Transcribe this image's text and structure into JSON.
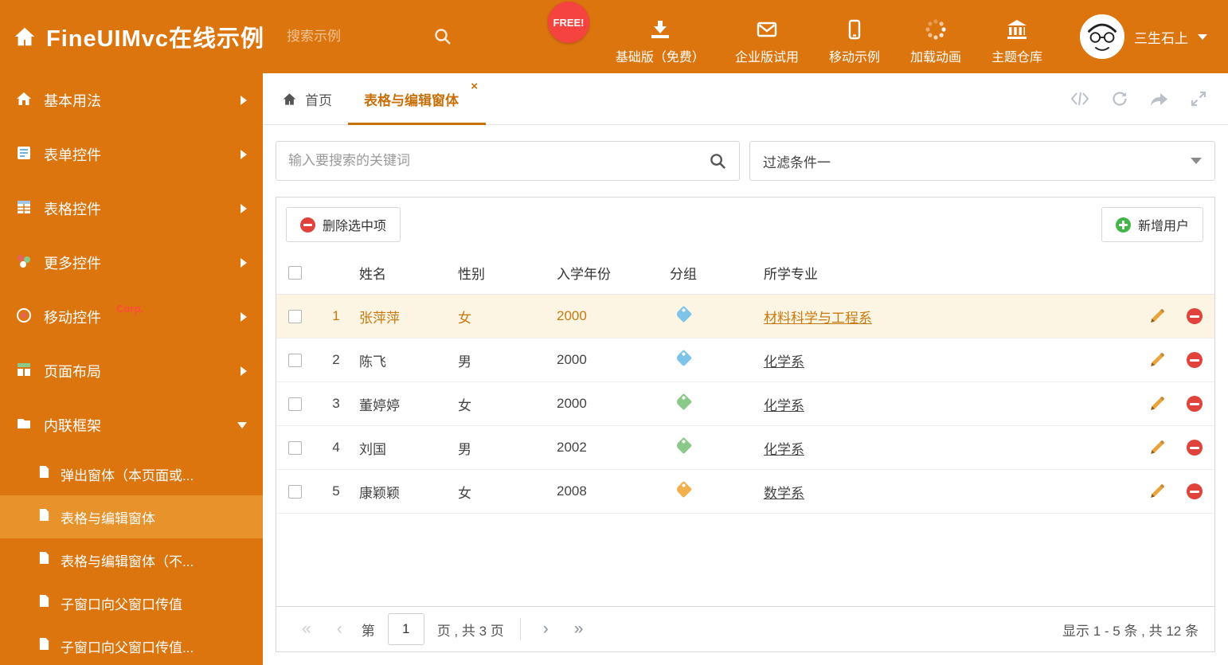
{
  "colors": {
    "brand": "#DD750F",
    "sidebar_active_bg": "#E8922B",
    "free_badge_bg": "#F5433F",
    "corp_badge_color": "#FF4A3D",
    "active_tab": "#C8700A",
    "selected_row_bg": "#FCF5E4",
    "selected_row_text": "#C8790F",
    "delete_icon": "#E0433B",
    "add_icon": "#44B549"
  },
  "header": {
    "title": "FineUIMvc在线示例",
    "search_placeholder": "搜索示例",
    "free_badge": "FREE!",
    "nav": [
      {
        "label": "基础版（免费）",
        "icon": "download-icon"
      },
      {
        "label": "企业版试用",
        "icon": "envelope-icon"
      },
      {
        "label": "移动示例",
        "icon": "mobile-icon"
      },
      {
        "label": "加载动画",
        "icon": "spinner-icon"
      },
      {
        "label": "主题仓库",
        "icon": "bank-icon"
      }
    ],
    "user_name": "三生石上"
  },
  "sidebar": {
    "items": [
      {
        "label": "基本用法"
      },
      {
        "label": "表单控件"
      },
      {
        "label": "表格控件"
      },
      {
        "label": "更多控件"
      },
      {
        "label": "移动控件",
        "badge": "Corp."
      },
      {
        "label": "页面布局"
      },
      {
        "label": "内联框架"
      }
    ],
    "subitems": [
      {
        "label": "弹出窗体（本页面或..."
      },
      {
        "label": "表格与编辑窗体"
      },
      {
        "label": "表格与编辑窗体（不..."
      },
      {
        "label": "子窗口向父窗口传值"
      },
      {
        "label": "子窗口向父窗口传值..."
      }
    ]
  },
  "tabs": {
    "home": "首页",
    "active": "表格与编辑窗体",
    "close": "×"
  },
  "filter": {
    "search_placeholder": "输入要搜索的关键词",
    "dropdown_value": "过滤条件一"
  },
  "toolbar": {
    "delete_label": "删除选中项",
    "add_label": "新增用户"
  },
  "table": {
    "columns": {
      "name": "姓名",
      "gender": "性别",
      "year": "入学年份",
      "group": "分组",
      "major": "所学专业"
    },
    "rows": [
      {
        "num": "1",
        "name": "张萍萍",
        "gender": "女",
        "year": "2000",
        "tag_color": "#7EC3E8",
        "major": "材料科学与工程系"
      },
      {
        "num": "2",
        "name": "陈飞",
        "gender": "男",
        "year": "2000",
        "tag_color": "#7EC3E8",
        "major": "化学系"
      },
      {
        "num": "3",
        "name": "董婷婷",
        "gender": "女",
        "year": "2000",
        "tag_color": "#8BC98B",
        "major": "化学系"
      },
      {
        "num": "4",
        "name": "刘国",
        "gender": "男",
        "year": "2002",
        "tag_color": "#8BC98B",
        "major": "化学系"
      },
      {
        "num": "5",
        "name": "康颖颖",
        "gender": "女",
        "year": "2008",
        "tag_color": "#F2B04E",
        "major": "数学系"
      }
    ]
  },
  "pagination": {
    "first": "«",
    "prev": "‹",
    "page_prefix": "第",
    "page_value": "1",
    "page_suffix": "页 , 共 3 页",
    "next": "›",
    "last": "»",
    "summary": "显示 1 - 5 条 , 共 12 条"
  }
}
